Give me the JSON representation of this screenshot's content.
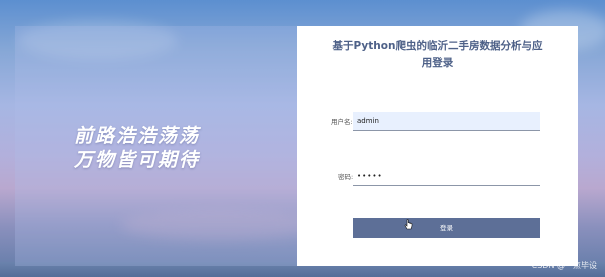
{
  "hero": {
    "slogan_line1": "前路浩浩荡荡",
    "slogan_line2": "万物皆可期待"
  },
  "login": {
    "title_line1": "基于Python爬虫的临沂二手房数据分析与应",
    "title_line2": "用登录",
    "username_label": "用户名:",
    "username_value": "admin",
    "password_label": "密码:",
    "password_value": "•••••",
    "submit_label": "登录"
  },
  "watermark": "CSDN @一点毕设",
  "colors": {
    "title": "#4e6188",
    "button": "#5d6f97",
    "username_field_bg": "#e8f0fe",
    "card_bg": "#ffffff"
  },
  "icons": {
    "cursor": "hand-pointer-icon"
  }
}
